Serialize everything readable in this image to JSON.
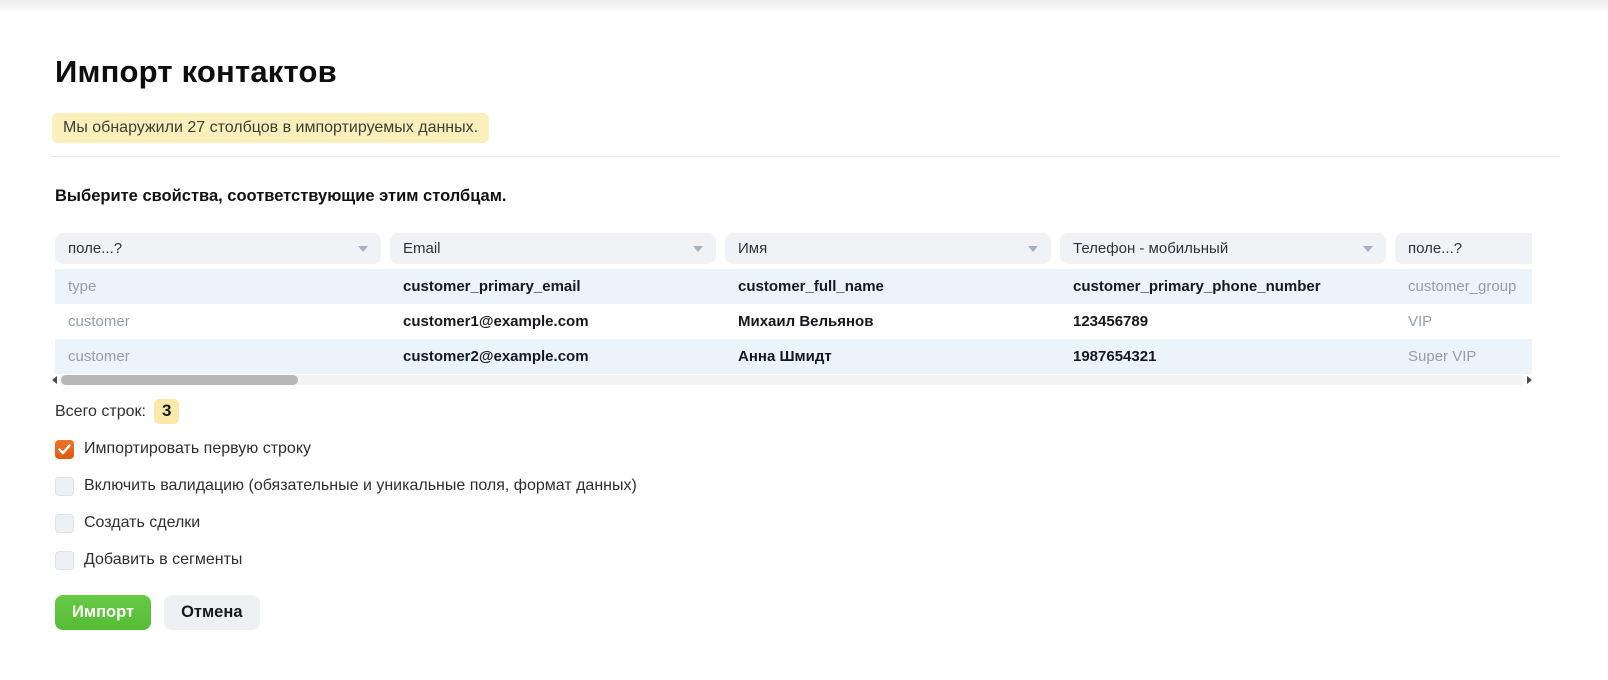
{
  "page": {
    "title": "Импорт контактов",
    "banner": "Мы обнаружили 27 столбцов в импортируемых данных.",
    "section_title": "Выберите свойства, соответствующие этим столбцам."
  },
  "mapping": {
    "columns": [
      {
        "dropdown": "поле...?",
        "mapped": false,
        "cells": [
          "type",
          "customer",
          "customer"
        ]
      },
      {
        "dropdown": "Email",
        "mapped": true,
        "cells": [
          "customer_primary_email",
          "customer1@example.com",
          "customer2@example.com"
        ]
      },
      {
        "dropdown": "Имя",
        "mapped": true,
        "cells": [
          "customer_full_name",
          "Михаил Вельянов",
          "Анна Шмидт"
        ]
      },
      {
        "dropdown": "Телефон - мобильный",
        "mapped": true,
        "cells": [
          "customer_primary_phone_number",
          "123456789",
          "1987654321"
        ]
      },
      {
        "dropdown": "поле...?",
        "mapped": false,
        "cells": [
          "customer_group",
          "VIP",
          "Super VIP"
        ]
      }
    ]
  },
  "summary": {
    "total_rows_label": "Всего строк:",
    "total_rows_value": "3"
  },
  "options": {
    "checkboxes": [
      {
        "label": "Импортировать первую строку",
        "checked": true
      },
      {
        "label": "Включить валидацию (обязательные и уникальные поля, формат данных)",
        "checked": false
      },
      {
        "label": "Создать сделки",
        "checked": false
      },
      {
        "label": "Добавить в сегменты",
        "checked": false
      }
    ]
  },
  "actions": {
    "import_label": "Импорт",
    "cancel_label": "Отмена"
  },
  "colors": {
    "banner_yellow": "#fbf0bb",
    "badge_yellow": "#fbe9ac",
    "row_stripe_blue": "#ecf4fb",
    "dropdown_gray": "#f0f2f6",
    "checkbox_orange": "#e2611c",
    "import_green": "#5cc23c",
    "cancel_gray": "#eef0f3",
    "dim_text": "#939ea9"
  }
}
